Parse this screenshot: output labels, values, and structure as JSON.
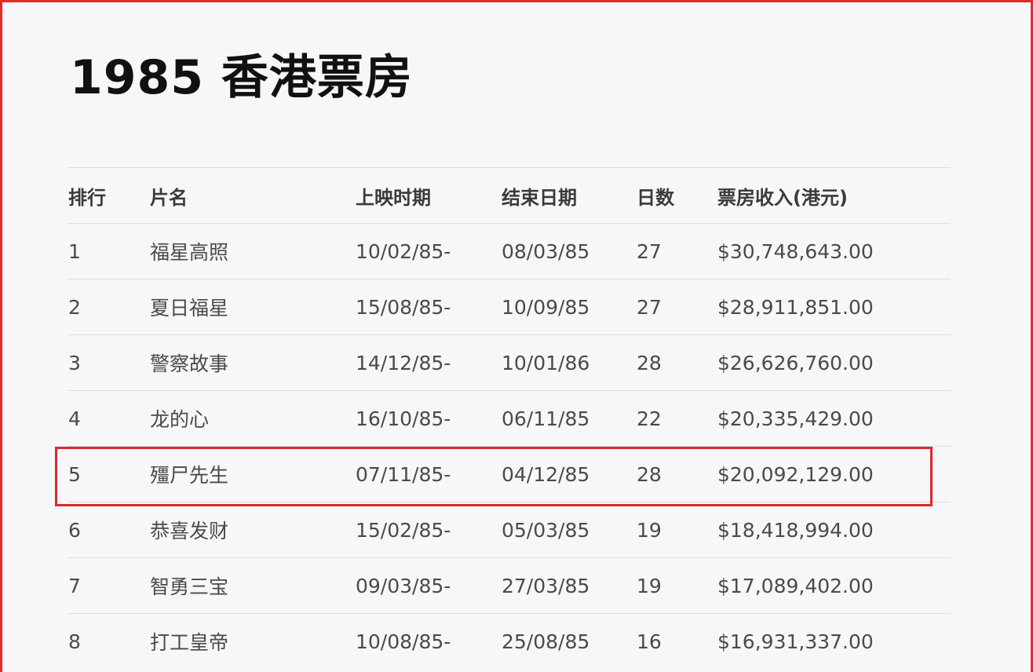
{
  "title": "1985 香港票房",
  "colors": {
    "frame": "#e02b2b",
    "highlight": "#d9292f",
    "background": "#f7f7f9"
  },
  "table": {
    "headers": [
      "排行",
      "片名",
      "上映时期",
      "结束日期",
      "日数",
      "票房收入(港元)"
    ],
    "rows": [
      [
        "1",
        "福星高照",
        "10/02/85-",
        "08/03/85",
        "27",
        "$30,748,643.00"
      ],
      [
        "2",
        "夏日福星",
        "15/08/85-",
        "10/09/85",
        "27",
        "$28,911,851.00"
      ],
      [
        "3",
        "警察故事",
        "14/12/85-",
        "10/01/86",
        "28",
        "$26,626,760.00"
      ],
      [
        "4",
        "龙的心",
        "16/10/85-",
        "06/11/85",
        "22",
        "$20,335,429.00"
      ],
      [
        "5",
        "殭尸先生",
        "07/11/85-",
        "04/12/85",
        "28",
        "$20,092,129.00"
      ],
      [
        "6",
        "恭喜发财",
        "15/02/85-",
        "05/03/85",
        "19",
        "$18,418,994.00"
      ],
      [
        "7",
        "智勇三宝",
        "09/03/85-",
        "27/03/85",
        "19",
        "$17,089,402.00"
      ],
      [
        "8",
        "打工皇帝",
        "10/08/85-",
        "25/08/85",
        "16",
        "$16,931,337.00"
      ]
    ],
    "highlighted_rank": "5"
  }
}
